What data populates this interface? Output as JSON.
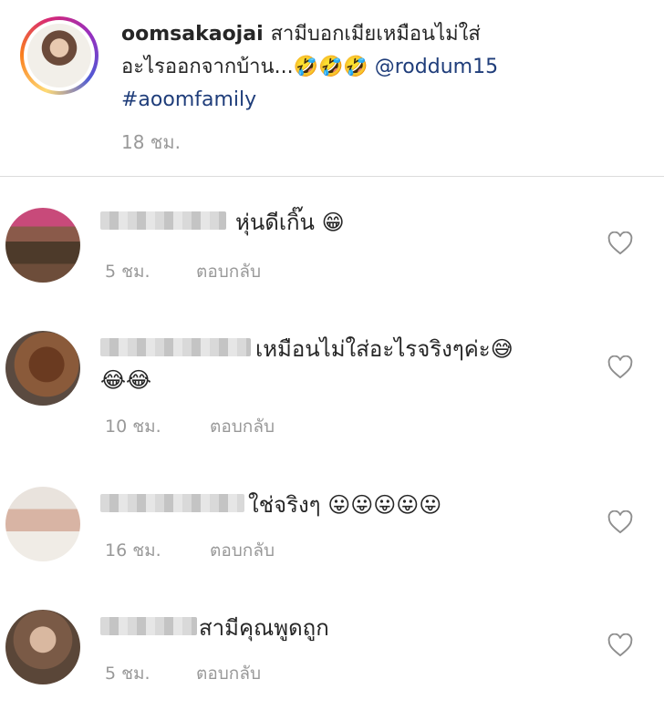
{
  "post": {
    "username": "oomsakaojai",
    "caption_line1": "สามีบอกเมียเหมือนไม่ใส่",
    "caption_line2": "อะไรออกจากบ้าน...",
    "caption_emojis": "🤣🤣🤣",
    "mention": "@roddum15",
    "hashtag": "#aoomfamily",
    "time": "18 ชม."
  },
  "comments": [
    {
      "text": "หุ่นดีเกิ๊น",
      "emoji": "😁",
      "time": "5 ชม.",
      "reply_label": "ตอบกลับ"
    },
    {
      "text": "เหมือนไม่ใส่อะไรจริงๆค่ะ",
      "emoji": "😅",
      "emoji_line2": "😂😂",
      "time": "10 ชม.",
      "reply_label": "ตอบกลับ"
    },
    {
      "text": "ใช่จริงๆ",
      "emoji": "😛😛😛😛😛",
      "time": "16 ชม.",
      "reply_label": "ตอบกลับ"
    },
    {
      "text": "สามีคุณพูดถูก",
      "emoji": "",
      "time": "5 ชม.",
      "reply_label": "ตอบกลับ"
    }
  ],
  "icons": {
    "like": "heart-outline-icon"
  },
  "colors": {
    "text": "#262626",
    "meta": "#999999",
    "link": "#1f3d7a",
    "divider": "#dbdbdb"
  }
}
